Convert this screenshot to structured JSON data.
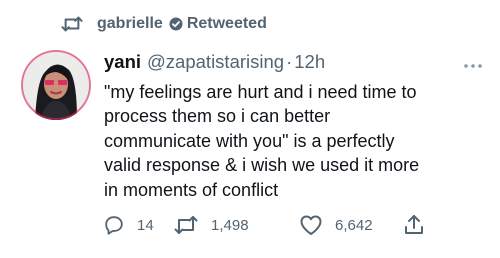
{
  "retweet_context": {
    "name": "gabrielle",
    "label": "Retweeted"
  },
  "tweet": {
    "author_name": "yani",
    "handle": "@zapatistarising",
    "separator": "·",
    "time": "12h",
    "text": "\"my feelings are hurt and i need time to\nprocess them so i can better\ncommunicate with you\" is a perfectly\nvalid response & i wish we used it more\nin moments of conflict",
    "actions": {
      "replies": "14",
      "retweets": "1,498",
      "likes": "6,642"
    }
  },
  "icons": [
    "retweet-icon",
    "verified-badge-icon",
    "avatar",
    "more-icon",
    "reply-icon",
    "like-icon",
    "share-icon"
  ],
  "colors": {
    "text_primary": "#0f1419",
    "text_secondary": "#536471",
    "background": "#ffffff",
    "avatar_ring": "#e0245e"
  }
}
